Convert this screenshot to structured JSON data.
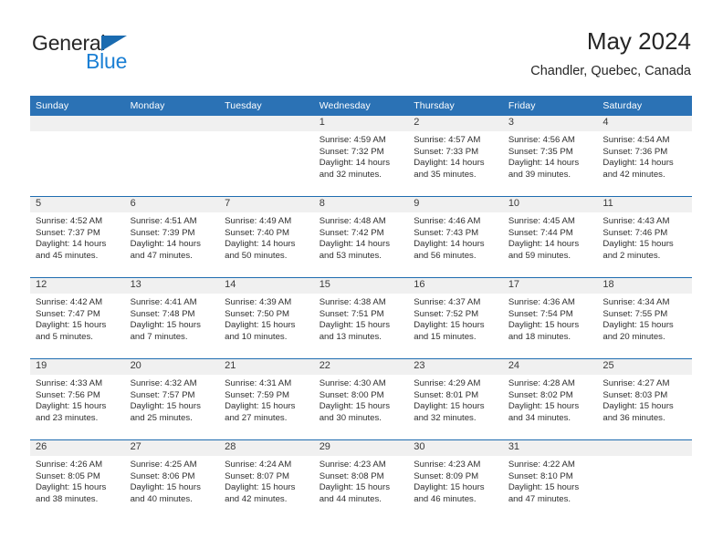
{
  "brand": {
    "name_part1": "General",
    "name_part2": "Blue",
    "logo_icon": "triangle-flag-icon",
    "color_dark": "#262626",
    "color_blue": "#1a7fd4"
  },
  "header": {
    "title": "May 2024",
    "subtitle": "Chandler, Quebec, Canada"
  },
  "theme": {
    "header_blue": "#2b72b5",
    "row_divider_blue": "#1f6cb0",
    "daynum_band": "#f0f0f0",
    "text": "#2f2f2f"
  },
  "weekday_headers": [
    "Sunday",
    "Monday",
    "Tuesday",
    "Wednesday",
    "Thursday",
    "Friday",
    "Saturday"
  ],
  "weeks": [
    [
      {
        "day": "",
        "blank": true,
        "sunrise": "",
        "sunset": "",
        "daylight_line1": "",
        "daylight_line2": ""
      },
      {
        "day": "",
        "blank": true,
        "sunrise": "",
        "sunset": "",
        "daylight_line1": "",
        "daylight_line2": ""
      },
      {
        "day": "",
        "blank": true,
        "sunrise": "",
        "sunset": "",
        "daylight_line1": "",
        "daylight_line2": ""
      },
      {
        "day": "1",
        "blank": false,
        "sunrise": "Sunrise: 4:59 AM",
        "sunset": "Sunset: 7:32 PM",
        "daylight_line1": "Daylight: 14 hours",
        "daylight_line2": "and 32 minutes."
      },
      {
        "day": "2",
        "blank": false,
        "sunrise": "Sunrise: 4:57 AM",
        "sunset": "Sunset: 7:33 PM",
        "daylight_line1": "Daylight: 14 hours",
        "daylight_line2": "and 35 minutes."
      },
      {
        "day": "3",
        "blank": false,
        "sunrise": "Sunrise: 4:56 AM",
        "sunset": "Sunset: 7:35 PM",
        "daylight_line1": "Daylight: 14 hours",
        "daylight_line2": "and 39 minutes."
      },
      {
        "day": "4",
        "blank": false,
        "sunrise": "Sunrise: 4:54 AM",
        "sunset": "Sunset: 7:36 PM",
        "daylight_line1": "Daylight: 14 hours",
        "daylight_line2": "and 42 minutes."
      }
    ],
    [
      {
        "day": "5",
        "blank": false,
        "sunrise": "Sunrise: 4:52 AM",
        "sunset": "Sunset: 7:37 PM",
        "daylight_line1": "Daylight: 14 hours",
        "daylight_line2": "and 45 minutes."
      },
      {
        "day": "6",
        "blank": false,
        "sunrise": "Sunrise: 4:51 AM",
        "sunset": "Sunset: 7:39 PM",
        "daylight_line1": "Daylight: 14 hours",
        "daylight_line2": "and 47 minutes."
      },
      {
        "day": "7",
        "blank": false,
        "sunrise": "Sunrise: 4:49 AM",
        "sunset": "Sunset: 7:40 PM",
        "daylight_line1": "Daylight: 14 hours",
        "daylight_line2": "and 50 minutes."
      },
      {
        "day": "8",
        "blank": false,
        "sunrise": "Sunrise: 4:48 AM",
        "sunset": "Sunset: 7:42 PM",
        "daylight_line1": "Daylight: 14 hours",
        "daylight_line2": "and 53 minutes."
      },
      {
        "day": "9",
        "blank": false,
        "sunrise": "Sunrise: 4:46 AM",
        "sunset": "Sunset: 7:43 PM",
        "daylight_line1": "Daylight: 14 hours",
        "daylight_line2": "and 56 minutes."
      },
      {
        "day": "10",
        "blank": false,
        "sunrise": "Sunrise: 4:45 AM",
        "sunset": "Sunset: 7:44 PM",
        "daylight_line1": "Daylight: 14 hours",
        "daylight_line2": "and 59 minutes."
      },
      {
        "day": "11",
        "blank": false,
        "sunrise": "Sunrise: 4:43 AM",
        "sunset": "Sunset: 7:46 PM",
        "daylight_line1": "Daylight: 15 hours",
        "daylight_line2": "and 2 minutes."
      }
    ],
    [
      {
        "day": "12",
        "blank": false,
        "sunrise": "Sunrise: 4:42 AM",
        "sunset": "Sunset: 7:47 PM",
        "daylight_line1": "Daylight: 15 hours",
        "daylight_line2": "and 5 minutes."
      },
      {
        "day": "13",
        "blank": false,
        "sunrise": "Sunrise: 4:41 AM",
        "sunset": "Sunset: 7:48 PM",
        "daylight_line1": "Daylight: 15 hours",
        "daylight_line2": "and 7 minutes."
      },
      {
        "day": "14",
        "blank": false,
        "sunrise": "Sunrise: 4:39 AM",
        "sunset": "Sunset: 7:50 PM",
        "daylight_line1": "Daylight: 15 hours",
        "daylight_line2": "and 10 minutes."
      },
      {
        "day": "15",
        "blank": false,
        "sunrise": "Sunrise: 4:38 AM",
        "sunset": "Sunset: 7:51 PM",
        "daylight_line1": "Daylight: 15 hours",
        "daylight_line2": "and 13 minutes."
      },
      {
        "day": "16",
        "blank": false,
        "sunrise": "Sunrise: 4:37 AM",
        "sunset": "Sunset: 7:52 PM",
        "daylight_line1": "Daylight: 15 hours",
        "daylight_line2": "and 15 minutes."
      },
      {
        "day": "17",
        "blank": false,
        "sunrise": "Sunrise: 4:36 AM",
        "sunset": "Sunset: 7:54 PM",
        "daylight_line1": "Daylight: 15 hours",
        "daylight_line2": "and 18 minutes."
      },
      {
        "day": "18",
        "blank": false,
        "sunrise": "Sunrise: 4:34 AM",
        "sunset": "Sunset: 7:55 PM",
        "daylight_line1": "Daylight: 15 hours",
        "daylight_line2": "and 20 minutes."
      }
    ],
    [
      {
        "day": "19",
        "blank": false,
        "sunrise": "Sunrise: 4:33 AM",
        "sunset": "Sunset: 7:56 PM",
        "daylight_line1": "Daylight: 15 hours",
        "daylight_line2": "and 23 minutes."
      },
      {
        "day": "20",
        "blank": false,
        "sunrise": "Sunrise: 4:32 AM",
        "sunset": "Sunset: 7:57 PM",
        "daylight_line1": "Daylight: 15 hours",
        "daylight_line2": "and 25 minutes."
      },
      {
        "day": "21",
        "blank": false,
        "sunrise": "Sunrise: 4:31 AM",
        "sunset": "Sunset: 7:59 PM",
        "daylight_line1": "Daylight: 15 hours",
        "daylight_line2": "and 27 minutes."
      },
      {
        "day": "22",
        "blank": false,
        "sunrise": "Sunrise: 4:30 AM",
        "sunset": "Sunset: 8:00 PM",
        "daylight_line1": "Daylight: 15 hours",
        "daylight_line2": "and 30 minutes."
      },
      {
        "day": "23",
        "blank": false,
        "sunrise": "Sunrise: 4:29 AM",
        "sunset": "Sunset: 8:01 PM",
        "daylight_line1": "Daylight: 15 hours",
        "daylight_line2": "and 32 minutes."
      },
      {
        "day": "24",
        "blank": false,
        "sunrise": "Sunrise: 4:28 AM",
        "sunset": "Sunset: 8:02 PM",
        "daylight_line1": "Daylight: 15 hours",
        "daylight_line2": "and 34 minutes."
      },
      {
        "day": "25",
        "blank": false,
        "sunrise": "Sunrise: 4:27 AM",
        "sunset": "Sunset: 8:03 PM",
        "daylight_line1": "Daylight: 15 hours",
        "daylight_line2": "and 36 minutes."
      }
    ],
    [
      {
        "day": "26",
        "blank": false,
        "sunrise": "Sunrise: 4:26 AM",
        "sunset": "Sunset: 8:05 PM",
        "daylight_line1": "Daylight: 15 hours",
        "daylight_line2": "and 38 minutes."
      },
      {
        "day": "27",
        "blank": false,
        "sunrise": "Sunrise: 4:25 AM",
        "sunset": "Sunset: 8:06 PM",
        "daylight_line1": "Daylight: 15 hours",
        "daylight_line2": "and 40 minutes."
      },
      {
        "day": "28",
        "blank": false,
        "sunrise": "Sunrise: 4:24 AM",
        "sunset": "Sunset: 8:07 PM",
        "daylight_line1": "Daylight: 15 hours",
        "daylight_line2": "and 42 minutes."
      },
      {
        "day": "29",
        "blank": false,
        "sunrise": "Sunrise: 4:23 AM",
        "sunset": "Sunset: 8:08 PM",
        "daylight_line1": "Daylight: 15 hours",
        "daylight_line2": "and 44 minutes."
      },
      {
        "day": "30",
        "blank": false,
        "sunrise": "Sunrise: 4:23 AM",
        "sunset": "Sunset: 8:09 PM",
        "daylight_line1": "Daylight: 15 hours",
        "daylight_line2": "and 46 minutes."
      },
      {
        "day": "31",
        "blank": false,
        "sunrise": "Sunrise: 4:22 AM",
        "sunset": "Sunset: 8:10 PM",
        "daylight_line1": "Daylight: 15 hours",
        "daylight_line2": "and 47 minutes."
      },
      {
        "day": "",
        "blank": true,
        "sunrise": "",
        "sunset": "",
        "daylight_line1": "",
        "daylight_line2": ""
      }
    ]
  ]
}
